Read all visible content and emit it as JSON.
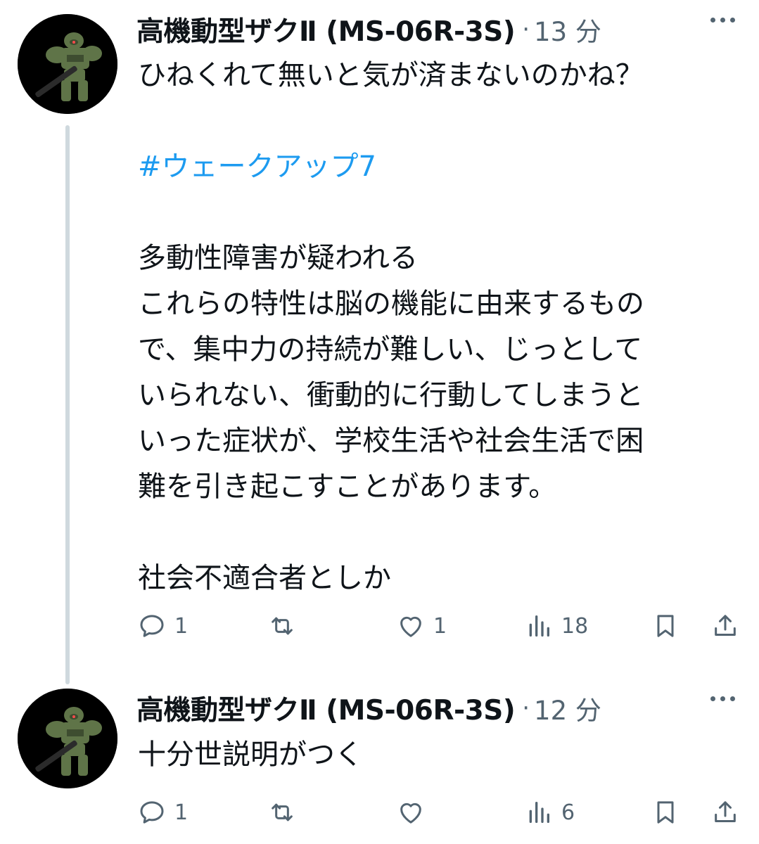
{
  "tweets": [
    {
      "display_name": "高機動型ザクⅡ (MS-06R-3S)",
      "separator": "·",
      "time": "13 分",
      "text_lines": [
        "ひねくれて無いと気が済まないのかね？",
        "",
        "#ウェークアップ7",
        "",
        "多動性障害が疑われる",
        "これらの特性は脳の機能に由来するもの",
        "で、集中力の持続が難しい、じっとして",
        "いられない、衝動的に行動してしまうと",
        "いった症状が、学校生活や社会生活で困",
        "難を引き起こすことがあります。",
        "",
        "社会不適合者としか"
      ],
      "hashtag": "#ウェークアップ7",
      "reply_count": "1",
      "retweet_count": "",
      "like_count": "1",
      "views_count": "18"
    },
    {
      "display_name": "高機動型ザクⅡ (MS-06R-3S)",
      "separator": "·",
      "time": "12 分",
      "text_lines": [
        "十分世説明がつく"
      ],
      "reply_count": "1",
      "retweet_count": "",
      "like_count": "",
      "views_count": "6"
    }
  ],
  "icons": {
    "reply": "reply-bubble-icon",
    "retweet": "retweet-arrows-icon",
    "like": "heart-icon",
    "views": "bar-chart-views-icon",
    "bookmark": "bookmark-icon",
    "share": "share-upload-icon",
    "more": "more-dots-icon"
  },
  "colors": {
    "text": "#0f1419",
    "secondary": "#536471",
    "hashtag": "#1d9bf0",
    "thread_line": "#cfd9de"
  }
}
